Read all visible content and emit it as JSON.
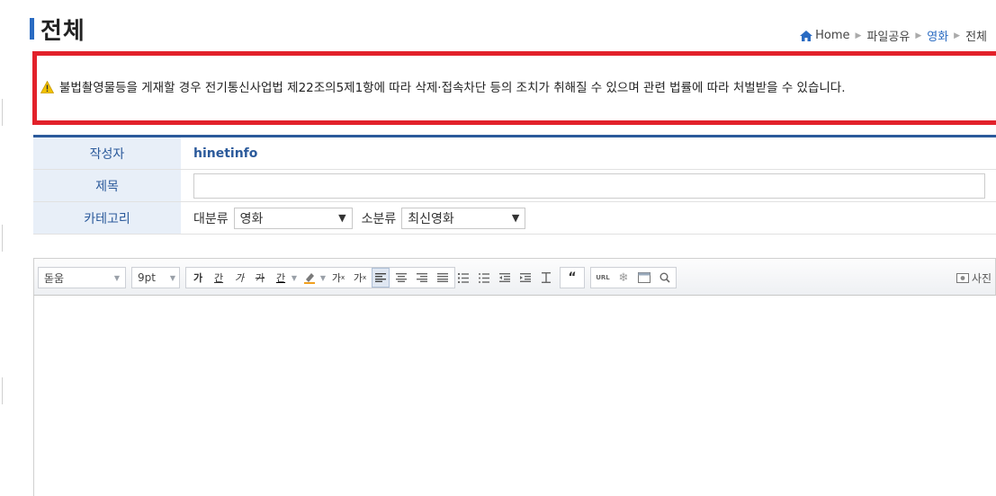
{
  "page": {
    "title": "전체"
  },
  "breadcrumb": {
    "items": [
      "Home",
      "파일공유",
      "영화",
      "전체"
    ],
    "active_color": "#2a6bc2"
  },
  "notice": {
    "icon": "warning-icon",
    "text": "불법촬영물등을 게재할 경우 전기통신사업법 제22조의5제1항에 따라 삭제·접속차단 등의 조치가 취해질 수 있으며 관련 법률에 따라 처벌받을 수 있습니다.",
    "border_color": "#e2212a"
  },
  "form": {
    "author_label": "작성자",
    "author_value": "hinetinfo",
    "subject_label": "제목",
    "subject_value": "",
    "category_label": "카테고리",
    "main_category_label": "대분류",
    "main_category_value": "영화",
    "sub_category_label": "소분류",
    "sub_category_value": "최신영화"
  },
  "toolbar": {
    "font_family": "돋움",
    "font_size": "9pt",
    "bold": "가",
    "underline": "간",
    "italic": "가",
    "strike": "가",
    "text_color": "간",
    "superscript": "가",
    "subscript": "가",
    "quote": "“",
    "url": "URL",
    "photo_label": "사진"
  },
  "colors": {
    "accent": "#2b5a9b",
    "label_bg": "#e8eff8"
  }
}
